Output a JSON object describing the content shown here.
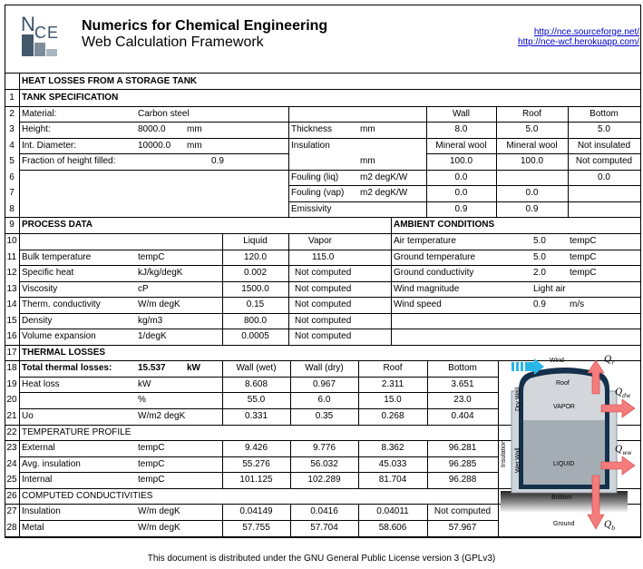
{
  "header": {
    "logo_text": "NCE",
    "title": "Numerics for Chemical Engineering",
    "subtitle": "Web Calculation Framework",
    "links": [
      "http://nce.sourceforge.net/",
      "http://nce-wcf.herokuapp.com/"
    ]
  },
  "doc_title": "HEAT LOSSES FROM A STORAGE TANK",
  "row_numbers": [
    "1",
    "2",
    "3",
    "4",
    "5",
    "6",
    "7",
    "8",
    "9",
    "10",
    "11",
    "12",
    "13",
    "14",
    "15",
    "16",
    "17",
    "18",
    "19",
    "20",
    "21",
    "22",
    "23",
    "24",
    "25",
    "26",
    "27",
    "28"
  ],
  "tank_spec": {
    "heading": "TANK SPECIFICATION",
    "material_label": "Material:",
    "material_value": "Carbon steel",
    "height_label": "Height:",
    "height_value": "8000.0",
    "height_unit": "mm",
    "diameter_label": "Int. Diameter:",
    "diameter_value": "10000.0",
    "diameter_unit": "mm",
    "fraction_label": "Fraction of height filled:",
    "fraction_value": "0.9",
    "columns": [
      "Wall",
      "Roof",
      "Bottom"
    ],
    "rows": [
      {
        "label": "Thickness",
        "unit": "mm",
        "values": [
          "8.0",
          "5.0",
          "5.0"
        ]
      },
      {
        "label": "Insulation",
        "unit": "",
        "values": [
          "Mineral wool",
          "Mineral wool",
          "Not insulated"
        ]
      },
      {
        "label": "",
        "unit": "mm",
        "values": [
          "100.0",
          "100.0",
          "Not computed"
        ]
      },
      {
        "label": "Fouling (liq)",
        "unit": "m2 degK/W",
        "values": [
          "0.0",
          "",
          "0.0"
        ]
      },
      {
        "label": "Fouling (vap)",
        "unit": "m2 degK/W",
        "values": [
          "0.0",
          "0.0",
          ""
        ]
      },
      {
        "label": "Emissivity",
        "unit": "",
        "values": [
          "0.9",
          "0.9",
          ""
        ]
      }
    ]
  },
  "process_data": {
    "heading": "PROCESS DATA",
    "columns": [
      "Liquid",
      "Vapor"
    ],
    "rows": [
      {
        "label": "Bulk temperature",
        "unit": "tempC",
        "values": [
          "120.0",
          "115.0"
        ]
      },
      {
        "label": "Specific heat",
        "unit": "kJ/kg/degK",
        "values": [
          "0.002",
          "Not computed"
        ]
      },
      {
        "label": "Viscosity",
        "unit": "cP",
        "values": [
          "1500.0",
          "Not computed"
        ]
      },
      {
        "label": "Therm. conductivity",
        "unit": "W/m degK",
        "values": [
          "0.15",
          "Not computed"
        ]
      },
      {
        "label": "Density",
        "unit": "kg/m3",
        "values": [
          "800.0",
          "Not computed"
        ]
      },
      {
        "label": "Volume expansion",
        "unit": "1/degK",
        "values": [
          "0.0005",
          "Not computed"
        ]
      }
    ]
  },
  "ambient": {
    "heading": "AMBIENT CONDITIONS",
    "rows": [
      {
        "label": "Air temperature",
        "value": "5.0",
        "unit": "tempC"
      },
      {
        "label": "Ground temperature",
        "value": "5.0",
        "unit": "tempC"
      },
      {
        "label": "Ground conductivity",
        "value": "2.0",
        "unit": "tempC"
      },
      {
        "label": "Wind magnitude",
        "value": "Light air",
        "unit": ""
      },
      {
        "label": "Wind speed",
        "value": "0.9",
        "unit": "m/s"
      }
    ]
  },
  "thermal_losses": {
    "heading": "THERMAL LOSSES",
    "total_label": "Total thermal losses:",
    "total_value": "15.537",
    "total_unit": "kW",
    "columns": [
      "Wall (wet)",
      "Wall (dry)",
      "Roof",
      "Bottom"
    ],
    "rows": [
      {
        "label": "Heat loss",
        "unit": "kW",
        "values": [
          "8.608",
          "0.967",
          "2.311",
          "3.651"
        ]
      },
      {
        "label": "",
        "unit": "%",
        "values": [
          "55.0",
          "6.0",
          "15.0",
          "23.0"
        ]
      },
      {
        "label": "Uo",
        "unit": "W/m2 degK",
        "values": [
          "0.331",
          "0.35",
          "0.268",
          "0.404"
        ]
      }
    ]
  },
  "temperature_profile": {
    "heading": "TEMPERATURE PROFILE",
    "rows": [
      {
        "label": "External",
        "unit": "tempC",
        "values": [
          "9.426",
          "9.776",
          "8.362",
          "96.281"
        ]
      },
      {
        "label": "Avg. insulation",
        "unit": "tempC",
        "values": [
          "55.276",
          "56.032",
          "45.033",
          "96.285"
        ]
      },
      {
        "label": "Internal",
        "unit": "tempC",
        "values": [
          "101.125",
          "102.289",
          "81.704",
          "96.288"
        ]
      }
    ]
  },
  "conductivities": {
    "heading": "COMPUTED CONDUCTIVITIES",
    "rows": [
      {
        "label": "Insulation",
        "unit": "W/m degK",
        "values": [
          "0.04149",
          "0.0416",
          "0.04011",
          "Not computed"
        ]
      },
      {
        "label": "Metal",
        "unit": "W/m degK",
        "values": [
          "57.755",
          "57.704",
          "58.606",
          "57.967"
        ]
      }
    ]
  },
  "diagram": {
    "wind": "Wind",
    "roof": "Roof",
    "vapor": "VAPOR",
    "liquid": "LIQUID",
    "bottom": "Bottom",
    "ground": "Ground",
    "dry_wall": "Dry Wall",
    "wet_wall": "Wet Wall",
    "insulation": "Insulation",
    "q_roof": "Q",
    "q_roof_sub": "r",
    "q_dry": "Q",
    "q_dry_sub": "dw",
    "q_wet": "Q",
    "q_wet_sub": "ww",
    "q_bottom": "Q",
    "q_bottom_sub": "b",
    "colors": {
      "arrow": "#f47c7c",
      "wind": "#29b6e8",
      "wall": "#14304a",
      "vapor": "#d3d7db",
      "liquid": "#a5adb4",
      "insulation": "#cfd5da"
    }
  },
  "footer": "This document is distributed under the GNU General Public License version 3 (GPLv3)"
}
